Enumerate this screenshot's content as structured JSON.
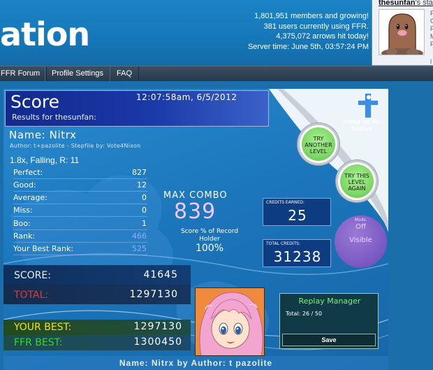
{
  "site": {
    "logo_text": "ation",
    "stats": [
      "1,801,951 members and growing!",
      "381 users currently using FFR.",
      "4,375,072 arrows hit today!",
      "Server time: June 5th, 03:57:24 PM"
    ]
  },
  "user_panel": {
    "username": "thesunfan",
    "username_suffix": "'s sta",
    "side_letters": [
      "F",
      "C",
      "F",
      "M",
      "F",
      "l"
    ]
  },
  "nav": {
    "items": [
      "FFR Forum",
      "Profile Settings",
      "FAQ"
    ]
  },
  "results": {
    "title": "Score",
    "timestamp": "12:07:58am, 6/5/2012",
    "results_for": "Results for thesunfan:",
    "song_name": "Name: Nitrx",
    "author_line": "Author: t+pazolite   -   Stepfile by: Vote4Nixon",
    "mods_line": "1.8x, Falling, R: 11",
    "judgements": [
      {
        "label": "Perfect:",
        "value": "827"
      },
      {
        "label": "Good:",
        "value": "12"
      },
      {
        "label": "Average:",
        "value": "0"
      },
      {
        "label": "Miss:",
        "value": "0"
      },
      {
        "label": "Boo:",
        "value": "1"
      },
      {
        "label": "Rank:",
        "value": "466"
      },
      {
        "label": "Your Best Rank:",
        "value": "525"
      }
    ],
    "max_combo_label": "MAX COMBO",
    "max_combo_value": "839",
    "record_holder_label": "Score % of Record Holder",
    "record_holder_value": "100%",
    "credits_earned_label": "CREDITS EARNED:",
    "credits_earned_value": "25",
    "total_credits_label": "TOTAL CREDITS:",
    "total_credits_value": "31238",
    "mods_circle": {
      "title": "Mods:",
      "off": "Off",
      "visible": "Visible"
    },
    "score_label": "SCORE:",
    "score_value": "41645",
    "total_label": "TOTAL:",
    "total_value": "1297130",
    "your_best_label": "YOUR BEST:",
    "your_best_value": "1297130",
    "ffr_best_label": "FFR BEST:",
    "ffr_best_value": "1300450",
    "press_for_hiscores": "Press for Hi-Scores",
    "try_another_level": "TRY ANOTHER LEVEL",
    "try_this_level_again": "TRY THIS LEVEL AGAIN",
    "replay_manager": {
      "title": "Replay Manager",
      "total": "Total: 26 / 50",
      "save": "Save"
    },
    "footer": "Name:  Nitrx  by  Author:  t  pazolite"
  },
  "colors": {
    "total_label": "#e03a3a",
    "your_best_label": "#f0e028",
    "ffr_best_label": "#39d626",
    "max_combo": "#f4c8f2",
    "mods_circle": "#7d5cc4",
    "round_button": "#7fd868"
  }
}
